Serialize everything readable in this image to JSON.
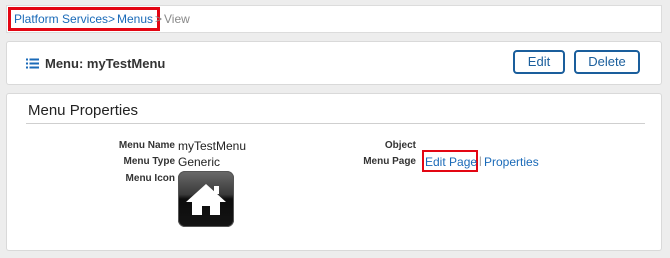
{
  "breadcrumb": {
    "platform_services": "Platform Services",
    "separator": ">",
    "menus": "Menus",
    "separator2": ">",
    "current": "View"
  },
  "header": {
    "title": "Menu: myTestMenu",
    "icon": "list-icon",
    "edit_label": "Edit",
    "delete_label": "Delete"
  },
  "properties": {
    "section_title": "Menu Properties",
    "menu_name_label": "Menu Name",
    "menu_name_value": "myTestMenu",
    "menu_type_label": "Menu Type",
    "menu_type_value": "Generic",
    "menu_icon_label": "Menu Icon",
    "menu_icon": "home-icon",
    "object_label": "Object",
    "object_value": "",
    "menu_page_label": "Menu Page",
    "edit_page_link": "Edit Page",
    "link_separator": "|",
    "properties_link": "Properties"
  },
  "colors": {
    "link": "#1a6ab8",
    "button_border": "#1a5e9c",
    "highlight": "#e30613",
    "background": "#ededed"
  }
}
